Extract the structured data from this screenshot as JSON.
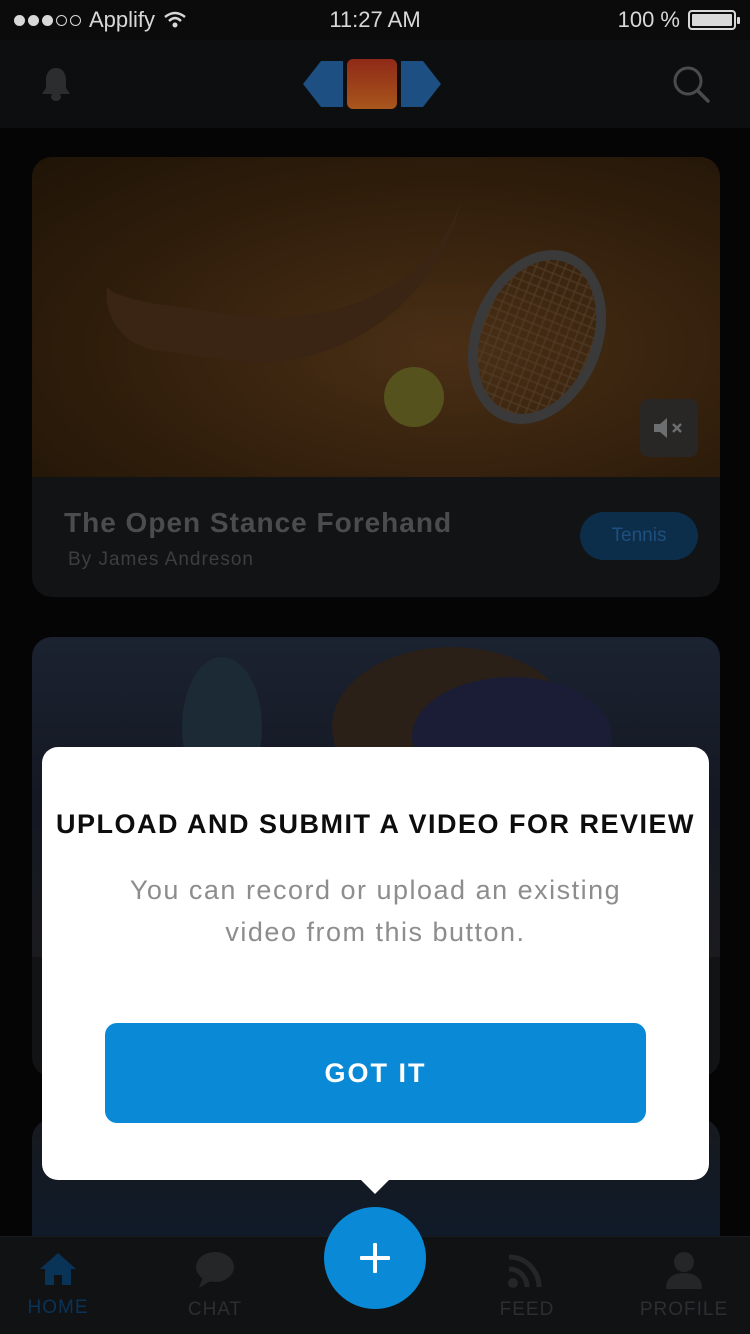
{
  "status_bar": {
    "carrier": "Applify",
    "time": "11:27 AM",
    "battery_text": "100 %",
    "battery_level": 1.0
  },
  "header": {
    "notifications_icon": "bell-icon",
    "logo_icon": "sports-logo",
    "search_icon": "search-icon"
  },
  "feed": {
    "cards": [
      {
        "title": "The Open Stance Forehand",
        "author": "By James Andreson",
        "tag": "Tennis",
        "mute_icon": "speaker-muted-icon"
      }
    ]
  },
  "popup": {
    "title": "UPLOAD AND SUBMIT A VIDEO FOR REVIEW",
    "body": "You can record or upload an existing video from this button.",
    "button_label": "GOT IT"
  },
  "fab": {
    "icon": "plus-icon"
  },
  "tabs": [
    {
      "label": "HOME",
      "icon": "home-icon",
      "active": true
    },
    {
      "label": "CHAT",
      "icon": "chat-bubble-icon",
      "active": false
    },
    {
      "label": "FEED",
      "icon": "rss-icon",
      "active": false
    },
    {
      "label": "PROFILE",
      "icon": "person-icon",
      "active": false
    }
  ],
  "colors": {
    "accent": "#0a8ad6",
    "active_tab": "#0a3358",
    "popup_bg": "#ffffff",
    "backdrop": "#050505"
  }
}
